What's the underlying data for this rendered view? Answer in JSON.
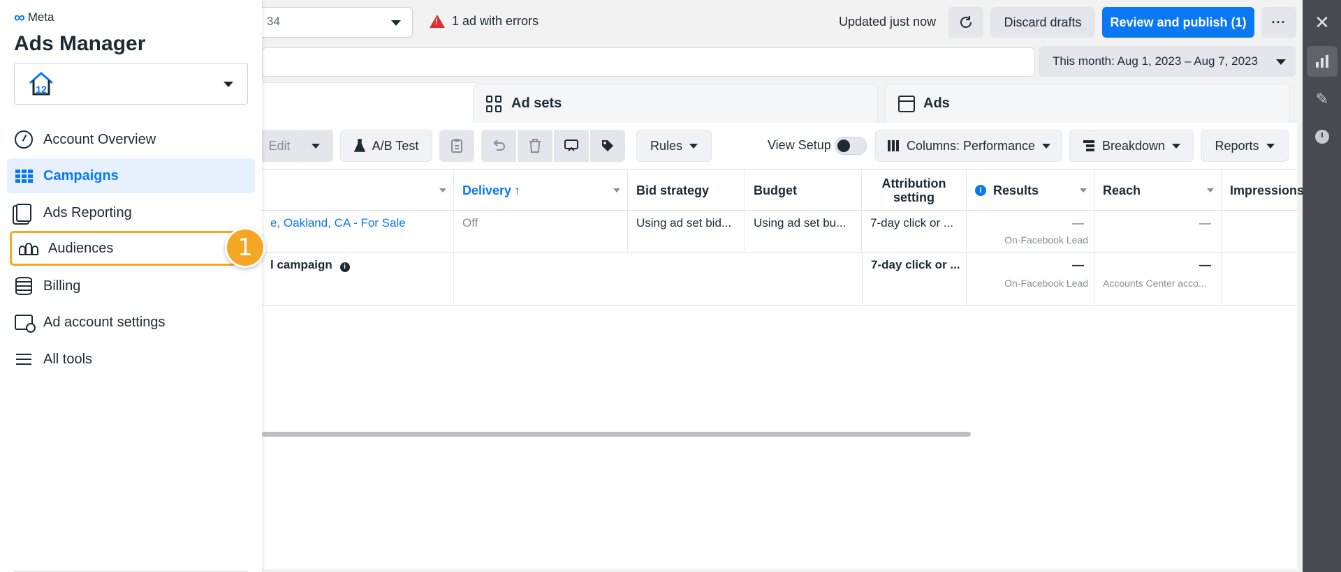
{
  "sidebar": {
    "brand": "Meta",
    "app_title": "Ads Manager",
    "items": [
      {
        "label": "Account Overview"
      },
      {
        "label": "Campaigns"
      },
      {
        "label": "Ads Reporting"
      },
      {
        "label": "Audiences"
      },
      {
        "label": "Billing"
      },
      {
        "label": "Ad account settings"
      },
      {
        "label": "All tools"
      }
    ],
    "step_badge": "1"
  },
  "topbar": {
    "account_partial": "34",
    "errors": "1 ad with errors",
    "updated": "Updated just now",
    "discard": "Discard drafts",
    "publish": "Review and publish (1)",
    "more": "···",
    "date_range": "This month: Aug 1, 2023 – Aug 7, 2023"
  },
  "tabs": {
    "adsets": "Ad sets",
    "ads": "Ads"
  },
  "toolbar": {
    "edit": "Edit",
    "ab_test": "A/B Test",
    "rules": "Rules",
    "view_setup": "View Setup",
    "columns": "Columns: Performance",
    "breakdown": "Breakdown",
    "reports": "Reports"
  },
  "table": {
    "headers": {
      "delivery": "Delivery",
      "bid_strategy": "Bid strategy",
      "budget": "Budget",
      "attribution": "Attribution setting",
      "results": "Results",
      "reach": "Reach",
      "impressions": "Impressions"
    },
    "rows": [
      {
        "name": "e, Oakland, CA - For Sale",
        "delivery": "Off",
        "bid_strategy": "Using ad set bid...",
        "budget": "Using ad set bu...",
        "attribution": "7-day click or ...",
        "results": "—",
        "results_sub": "On-Facebook Lead",
        "reach": "—"
      },
      {
        "name": "l campaign",
        "attribution": "7-day click or ...",
        "results": "—",
        "results_sub": "On-Facebook Lead",
        "reach": "—",
        "reach_sub": "Accounts Center acco..."
      }
    ]
  },
  "colors": {
    "primary": "#0a78f2",
    "highlight": "#f5a623",
    "rail": "#474a4f"
  }
}
